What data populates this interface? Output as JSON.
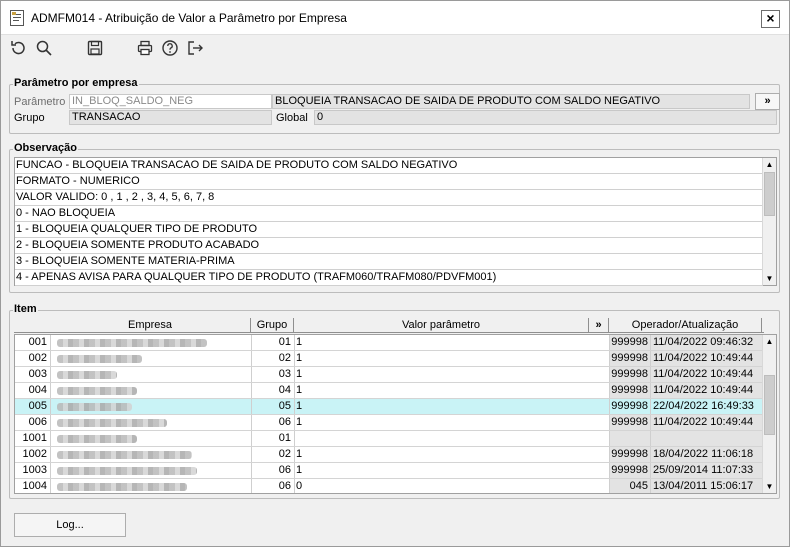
{
  "window": {
    "title": "ADMFM014 - Atribuição de Valor a Parâmetro por Empresa",
    "close_label": "×"
  },
  "toolbar": {
    "icons": [
      "undo-icon",
      "search-icon",
      "save-icon",
      "print-icon",
      "help-icon",
      "exit-icon"
    ]
  },
  "parametro_section": {
    "legend": "Parâmetro por empresa",
    "parametro_label": "Parâmetro",
    "parametro_value": "IN_BLOQ_SALDO_NEG",
    "descricao_value": "BLOQUEIA TRANSACAO DE SAIDA DE PRODUTO COM SALDO NEGATIVO",
    "more_button": "»",
    "grupo_label": "Grupo",
    "grupo_value": "TRANSACAO",
    "global_label": "Global",
    "global_value": "0"
  },
  "observacao_section": {
    "legend": "Observação",
    "lines": [
      "FUNCAO - BLOQUEIA TRANSACAO DE SAIDA DE PRODUTO COM SALDO NEGATIVO",
      "FORMATO - NUMERICO",
      "VALOR VALIDO: 0 , 1 , 2 , 3, 4, 5, 6, 7, 8",
      "0 - NAO BLOQUEIA",
      "1 - BLOQUEIA QUALQUER TIPO DE PRODUTO",
      "2 - BLOQUEIA SOMENTE PRODUTO ACABADO",
      "3 - BLOQUEIA SOMENTE MATERIA-PRIMA",
      "4 - APENAS AVISA PARA QUALQUER TIPO DE PRODUTO (TRAFM060/TRAFM080/PDVFM001)"
    ]
  },
  "item_section": {
    "legend": "Item",
    "headers": {
      "empresa": "Empresa",
      "grupo": "Grupo",
      "valor": "Valor parâmetro",
      "more": "»",
      "operador": "Operador/Atualização"
    },
    "rows": [
      {
        "code": "001",
        "grupo": "01",
        "valor": "1",
        "operador": "999998",
        "data": "11/04/2022 09:46:32"
      },
      {
        "code": "002",
        "grupo": "02",
        "valor": "1",
        "operador": "999998",
        "data": "11/04/2022 10:49:44"
      },
      {
        "code": "003",
        "grupo": "03",
        "valor": "1",
        "operador": "999998",
        "data": "11/04/2022 10:49:44"
      },
      {
        "code": "004",
        "grupo": "04",
        "valor": "1",
        "operador": "999998",
        "data": "11/04/2022 10:49:44"
      },
      {
        "code": "005",
        "grupo": "05",
        "valor": "1",
        "operador": "999998",
        "data": "22/04/2022 16:49:33",
        "selected": true
      },
      {
        "code": "006",
        "grupo": "06",
        "valor": "1",
        "operador": "999998",
        "data": "11/04/2022 10:49:44"
      },
      {
        "code": "1001",
        "grupo": "01",
        "valor": "",
        "operador": "",
        "data": ""
      },
      {
        "code": "1002",
        "grupo": "02",
        "valor": "1",
        "operador": "999998",
        "data": "18/04/2022 11:06:18"
      },
      {
        "code": "1003",
        "grupo": "06",
        "valor": "1",
        "operador": "999998",
        "data": "25/09/2014 11:07:33"
      },
      {
        "code": "1004",
        "grupo": "06",
        "valor": "0",
        "operador": "045",
        "data": "13/04/2011 15:06:17"
      }
    ]
  },
  "footer": {
    "log_button": "Log..."
  }
}
